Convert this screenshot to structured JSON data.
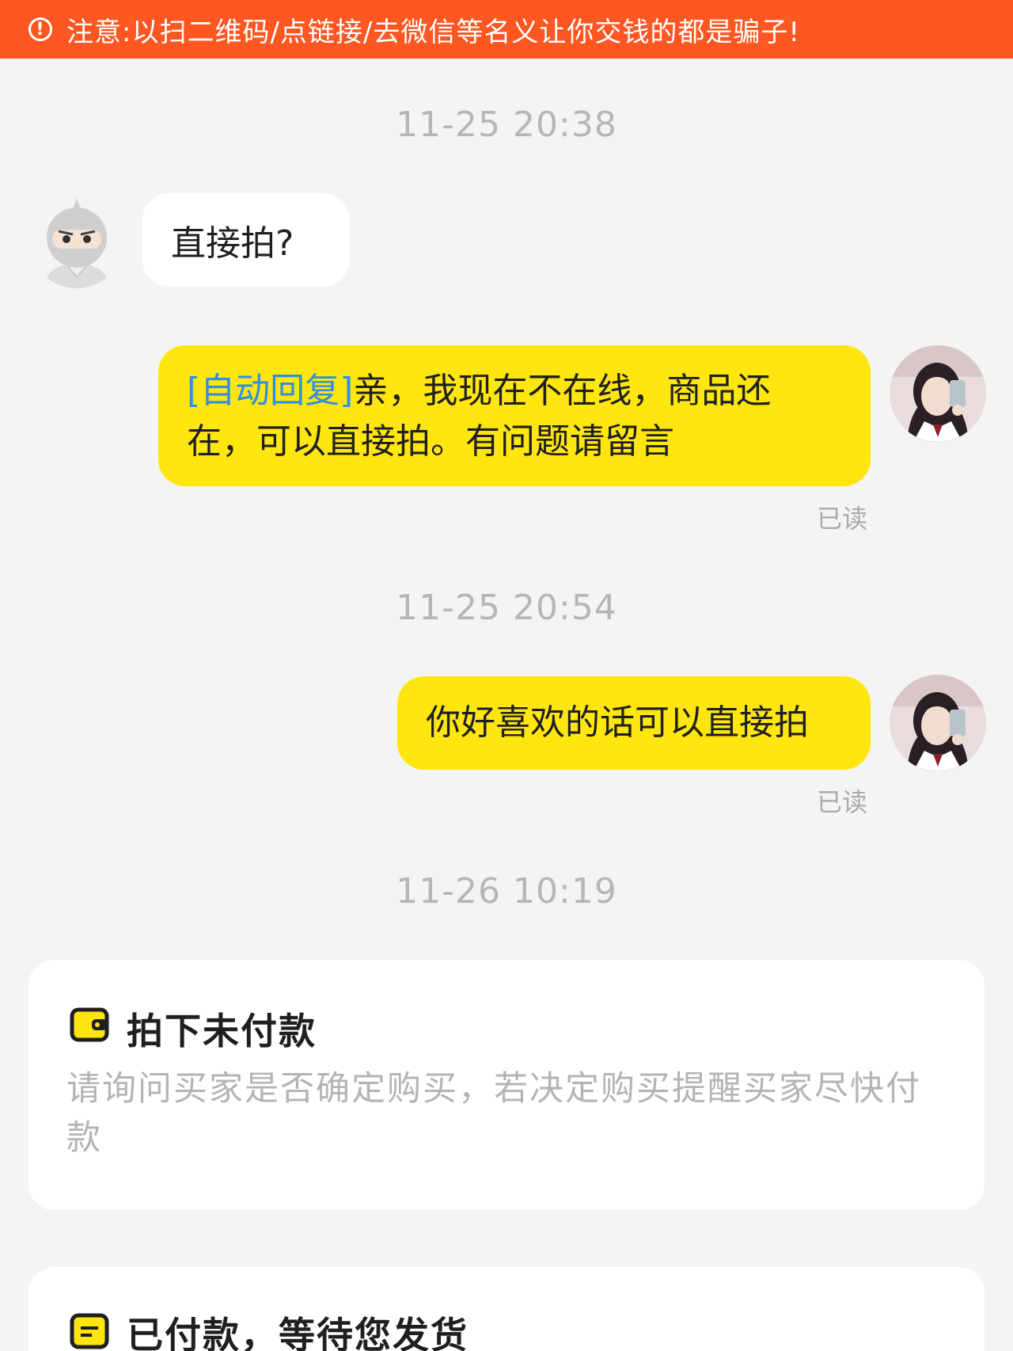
{
  "warning": {
    "icon": "alert-circle-icon",
    "text": "注意:以扫二维码/点链接/去微信等名义让你交钱的都是骗子!"
  },
  "messages": {
    "ts1": "11-25 20:38",
    "m1": "直接拍?",
    "m2_tag": "[自动回复]",
    "m2_line1": "亲，我现在不在线，商品还",
    "m2_line2": "在，可以直接拍。有问题请留言",
    "read1": "已读",
    "ts2": "11-25 20:54",
    "m3": "你好喜欢的话可以直接拍",
    "read2": "已读",
    "ts3": "11-26 10:19"
  },
  "cards": [
    {
      "icon": "wallet-icon",
      "title": "拍下未付款",
      "desc": "请询问买家是否确定购买，若决定购买提醒买家尽快付款"
    },
    {
      "icon": "package-icon",
      "title": "已付款，等待您发货"
    }
  ],
  "colors": {
    "warning_bg": "#ff5722",
    "bubble_self": "#ffe60f",
    "bubble_other": "#ffffff",
    "auto_reply_tag": "#2f8fe0",
    "page_bg": "#f4f4f4"
  }
}
